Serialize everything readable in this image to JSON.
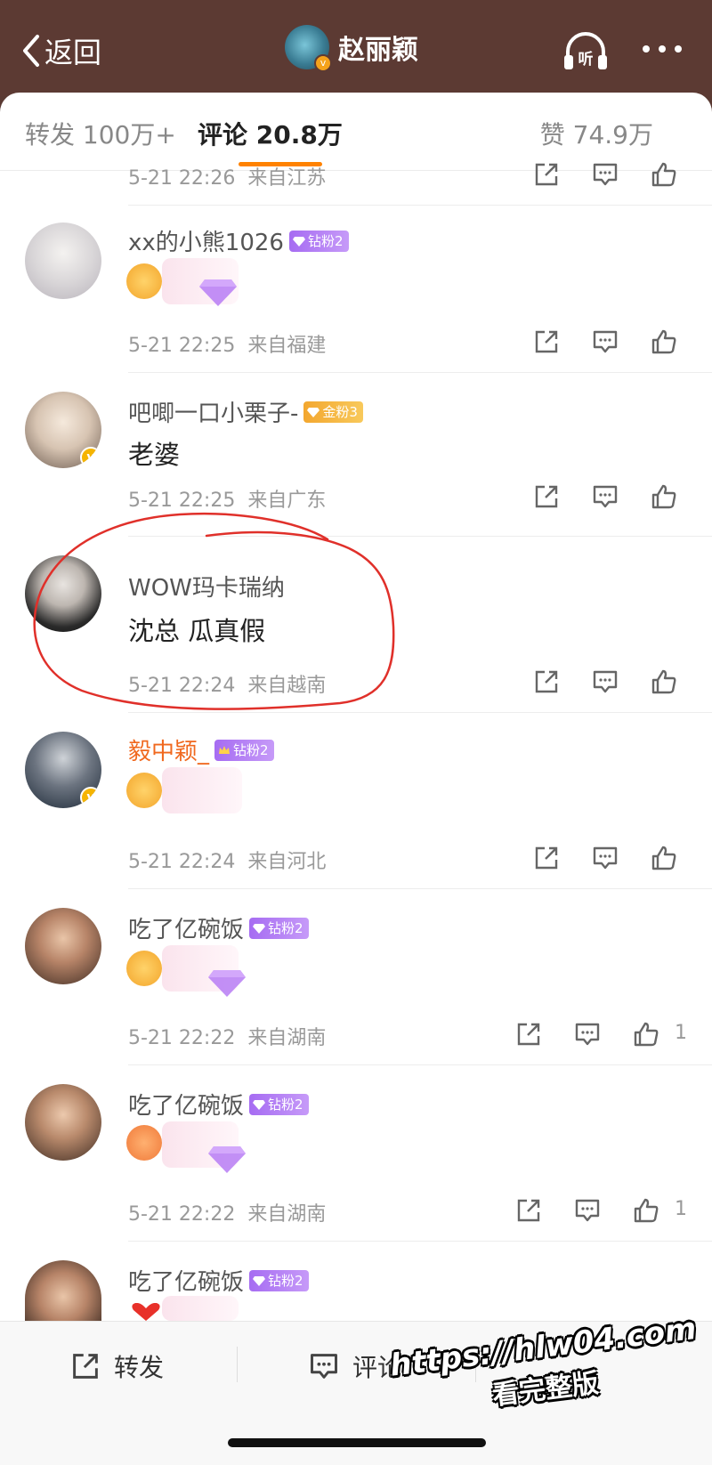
{
  "header": {
    "back_label": "返回",
    "title": "赵丽颖",
    "listen_label": "听"
  },
  "tabs": [
    {
      "label": "转发 100万+"
    },
    {
      "label": "评论 20.8万"
    },
    {
      "label": "赞 74.9万"
    }
  ],
  "comments": [
    {
      "time": "5-21 22:26",
      "location": "来自江苏"
    },
    {
      "name": "xx的小熊1026",
      "badge": "钻粉2",
      "time": "5-21 22:25",
      "location": "来自福建"
    },
    {
      "name": "吧唧一口小栗子-",
      "badge": "金粉3",
      "text": "老婆",
      "time": "5-21 22:25",
      "location": "来自广东"
    },
    {
      "name": "WOW玛卡瑞纳",
      "text": "沈总 瓜真假",
      "time": "5-21 22:24",
      "location": "来自越南"
    },
    {
      "name": "毅中颖_",
      "badge": "钻粉2",
      "time": "5-21 22:24",
      "location": "来自河北"
    },
    {
      "name": "吃了亿碗饭",
      "badge": "钻粉2",
      "time": "5-21 22:22",
      "location": "来自湖南",
      "likes": "1"
    },
    {
      "name": "吃了亿碗饭",
      "badge": "钻粉2",
      "time": "5-21 22:22",
      "location": "来自湖南",
      "likes": "1"
    },
    {
      "name": "吃了亿碗饭",
      "badge": "钻粉2"
    }
  ],
  "bottom_bar": {
    "repost_label": "转发",
    "comment_label": "评论"
  },
  "watermark": {
    "line1": "https://hlw04.com",
    "line2": "看完整版"
  },
  "colors": {
    "header_bg": "#5c3a33",
    "accent": "#ff8200",
    "fan_badge": "#a66cf2",
    "gold_badge": "#f3a72f",
    "annotation": "#e0302a"
  },
  "icons": [
    "chevron-left-icon",
    "listen-icon",
    "more-icon",
    "share-icon",
    "comment-icon",
    "like-icon"
  ]
}
